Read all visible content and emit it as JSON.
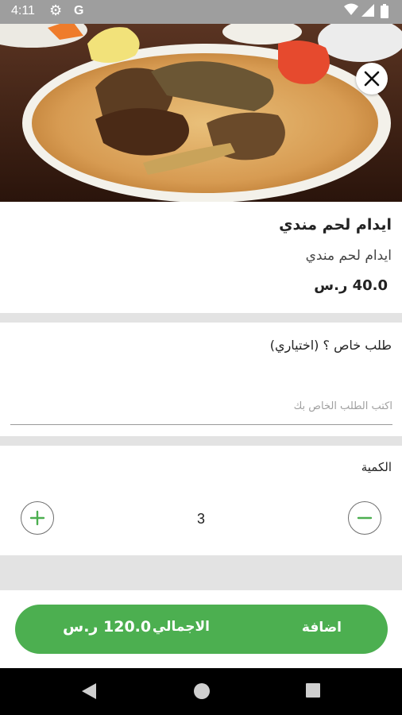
{
  "status_bar": {
    "time": "4:11",
    "google_glyph": "G",
    "icons": [
      "gear-icon",
      "google-icon",
      "wifi-icon",
      "signal-icon",
      "battery-icon"
    ]
  },
  "hero": {
    "image": "mandi-lamb-rice-platter",
    "close_icon": "close-icon"
  },
  "product": {
    "title": "ايدام لحم مندي",
    "description": "ايدام لحم مندي",
    "price": "40.0 ر.س"
  },
  "special_request": {
    "label": "طلب خاص ؟ (اختياري)",
    "placeholder": "اكتب الطلب الخاص بك",
    "value": ""
  },
  "quantity": {
    "label": "الكمية",
    "value": "3"
  },
  "footer": {
    "add_label": "اضافة",
    "total_label": "الاجمالي",
    "total_value": "120.0 ر.س"
  },
  "navigation_bar": {
    "icons": [
      "back-icon",
      "home-icon",
      "recents-icon"
    ]
  },
  "colors": {
    "accent": "#4caf50",
    "status_bar": "#9e9e9e",
    "divider": "#e3e3e3"
  }
}
